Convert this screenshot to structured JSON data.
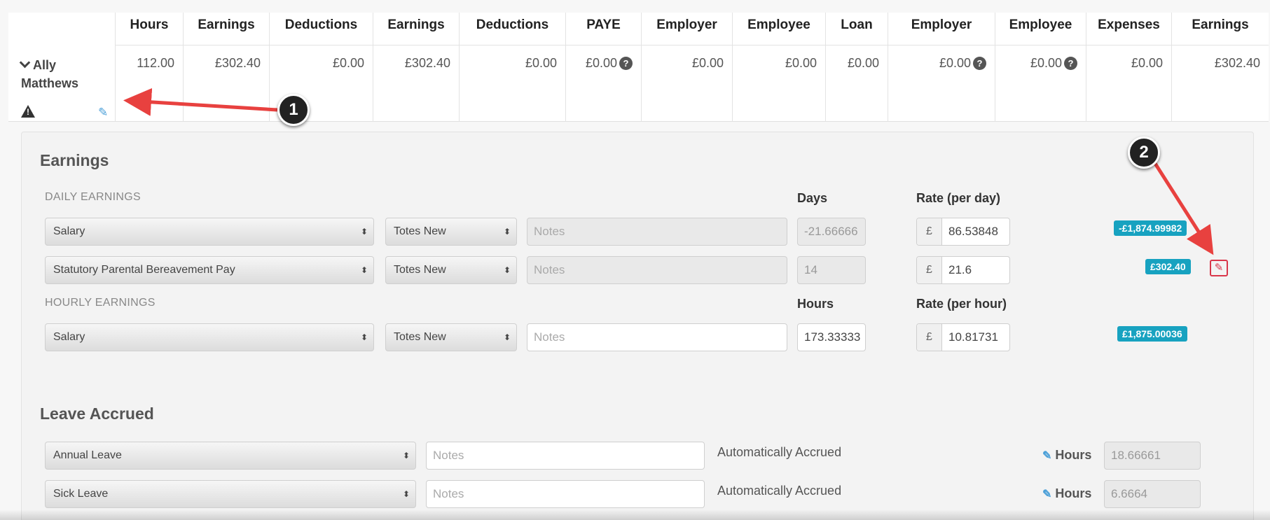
{
  "summary": {
    "columns": [
      {
        "header": "Hours",
        "value": "112.00",
        "info": false
      },
      {
        "header": "Earnings",
        "value": "£302.40",
        "info": false
      },
      {
        "header": "Deductions",
        "value": "£0.00",
        "info": false
      },
      {
        "header": "Earnings",
        "value": "£302.40",
        "info": false
      },
      {
        "header": "Deductions",
        "value": "£0.00",
        "info": false
      },
      {
        "header": "PAYE",
        "value": "£0.00",
        "info": true
      },
      {
        "header": "Employer",
        "value": "£0.00",
        "info": false
      },
      {
        "header": "Employee",
        "value": "£0.00",
        "info": false
      },
      {
        "header": "Loan",
        "value": "£0.00",
        "info": false
      },
      {
        "header": "Employer",
        "value": "£0.00",
        "info": true
      },
      {
        "header": "Employee",
        "value": "£0.00",
        "info": true
      },
      {
        "header": "Expenses",
        "value": "£0.00",
        "info": false
      },
      {
        "header": "Earnings",
        "value": "£302.40",
        "info": false
      }
    ],
    "employee": {
      "first": "Ally",
      "last": "Matthews"
    },
    "info_glyph": "?"
  },
  "earnings": {
    "title": "Earnings",
    "daily_label": "DAILY EARNINGS",
    "days_label": "Days",
    "rate_day_label": "Rate (per day)",
    "hourly_label": "HOURLY EARNINGS",
    "hours_label": "Hours",
    "rate_hour_label": "Rate (per hour)",
    "currency": "£",
    "daily_rows": [
      {
        "type": "Salary",
        "scheme": "Totes New",
        "notes_placeholder": "Notes",
        "qty": "-21.66666",
        "rate": "86.53848",
        "total": "-£1,874.99982"
      },
      {
        "type": "Statutory Parental Bereavement Pay",
        "scheme": "Totes New",
        "notes_placeholder": "Notes",
        "qty": "14",
        "rate": "21.6",
        "total": "£302.40"
      }
    ],
    "hourly_rows": [
      {
        "type": "Salary",
        "scheme": "Totes New",
        "notes_placeholder": "Notes",
        "qty": "173.33333",
        "rate": "10.81731",
        "total": "£1,875.00036"
      }
    ]
  },
  "leave": {
    "title": "Leave Accrued",
    "hours_label": "Hours",
    "rows": [
      {
        "type": "Annual Leave",
        "notes_placeholder": "Notes",
        "status": "Automatically Accrued",
        "hours": "18.66661"
      },
      {
        "type": "Sick Leave",
        "notes_placeholder": "Notes",
        "status": "Automatically Accrued",
        "hours": "6.6664"
      }
    ]
  },
  "annotations": {
    "marker1": "1",
    "marker2": "2",
    "arrow_color": "#e8413f"
  }
}
